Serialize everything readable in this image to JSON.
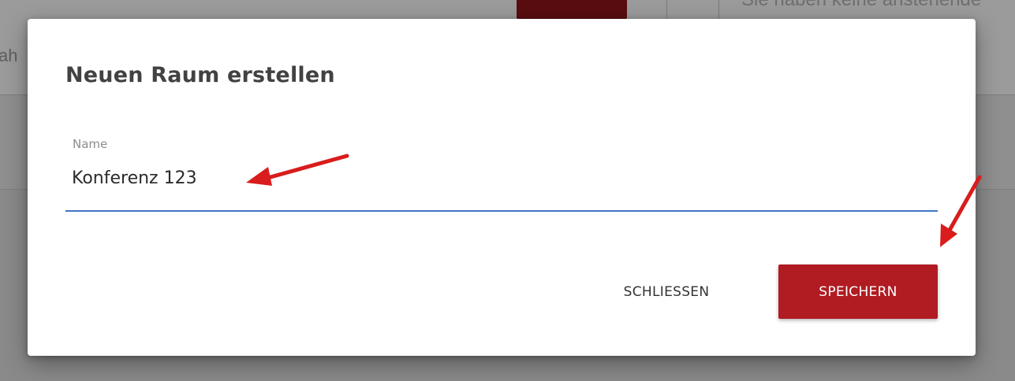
{
  "background": {
    "left_text": "ah",
    "right_text": "Sie haben keine anstehende"
  },
  "dialog": {
    "title": "Neuen Raum erstellen",
    "name_field": {
      "label": "Name",
      "value": "Konferenz 123"
    },
    "close_label": "SCHLIESSEN",
    "save_label": "SPEICHERN"
  },
  "annotations": {
    "arrow_icon": "arrow-icon",
    "arrow_color": "#d91c1c"
  },
  "colors": {
    "accent_red": "#b01c22",
    "underline_blue": "#3f73c6",
    "title_text": "#424242"
  }
}
